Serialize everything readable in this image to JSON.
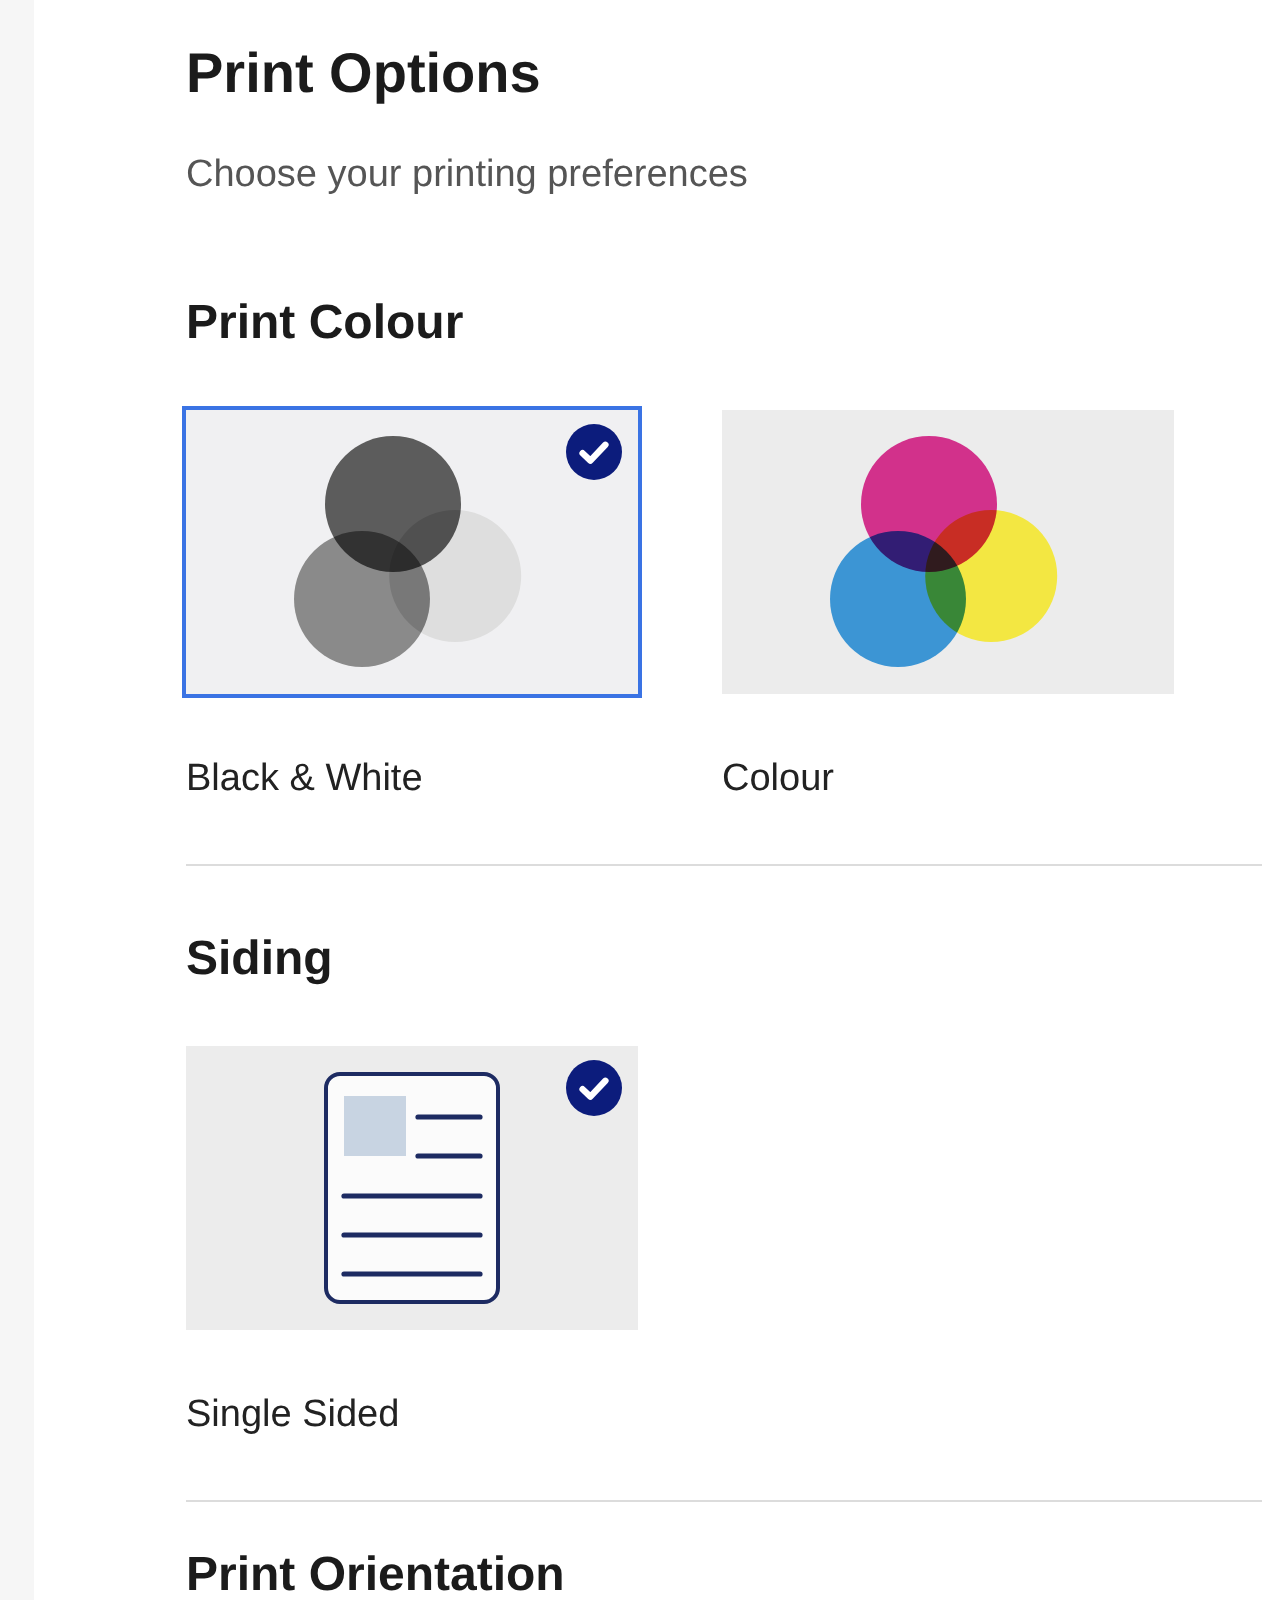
{
  "title": "Print Options",
  "subtitle": "Choose your printing preferences",
  "sections": [
    {
      "heading": "Print Colour",
      "options": [
        {
          "kind": "mono",
          "label": "Black & White",
          "selected": true,
          "focused": true
        },
        {
          "kind": "colour",
          "label": "Colour",
          "selected": false,
          "focused": false
        }
      ]
    },
    {
      "heading": "Siding",
      "options": [
        {
          "kind": "single_page",
          "label": "Single Sided",
          "selected": true,
          "focused": false
        }
      ]
    },
    {
      "heading": "Print Orientation"
    }
  ]
}
